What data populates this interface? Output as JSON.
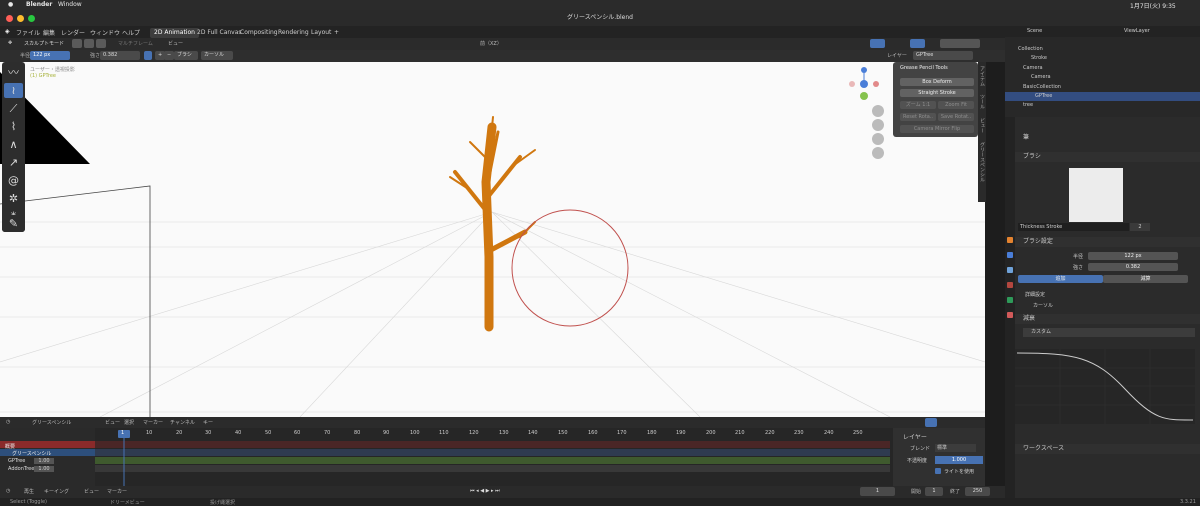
{
  "mac": {
    "app": "Blender",
    "menu_window": "Window",
    "clock": "1月7日(火) 9:35"
  },
  "title": "グリースペンシル.blend",
  "menu": {
    "items": [
      "ファイル",
      "編集",
      "レンダー",
      "ウィンドウ",
      "ヘルプ"
    ]
  },
  "workspaces": {
    "items": [
      "2D Animation",
      "2D Full Canvas",
      "Compositing",
      "Rendering",
      "Layout"
    ],
    "add": "+"
  },
  "header1": {
    "mode": "スカルプトモード",
    "multiframe": "マルチフレーム",
    "view": "ビュー",
    "orientation": "前（XZ）",
    "layer_label": "レイヤー",
    "layer": "GPTree"
  },
  "header2": {
    "radius_label": "半径",
    "radius": "122 px",
    "strength_label": "強さ",
    "strength": "0.382",
    "plus": "+",
    "minus": "−",
    "brush": "ブラシ",
    "cursor": "カーソル"
  },
  "viewport": {
    "overlay_line1": "ユーザー・透視投影",
    "overlay_line2": "(1) GPTree"
  },
  "gp_panel": {
    "title": "Grease Pencil Tools",
    "buttons": [
      "Box Deform",
      "Straight Stroke"
    ],
    "disabled": [
      "ズーム 1:1",
      "Zoom Fit",
      "Reset Rota..",
      "Save Rotat..",
      "Camera Mirror Flip"
    ]
  },
  "sidetabs": [
    "アイテム",
    "ツール",
    "ビュー",
    "グリースペンシル"
  ],
  "outliner": {
    "scene": "Scene",
    "viewlayer": "ViewLayer",
    "rows": [
      "Collection",
      "Stroke",
      "Camera",
      "Camera",
      "BasicCollection",
      "GPTree",
      "tree"
    ]
  },
  "props": {
    "brush_name": "筆",
    "brush_section": "ブラシ",
    "brush_preset": "Thickness Stroke",
    "users": "2",
    "settings_section": "ブラシ設定",
    "radius_label": "半径",
    "radius": "122 px",
    "strength_label": "強さ",
    "strength": "0.382",
    "add": "追加",
    "sub": "減算",
    "advanced": "詳細設定",
    "cursor": "カーソル",
    "falloff": "減衰",
    "custom": "カスタム",
    "workspace": "ワークスペース"
  },
  "timeline": {
    "editor": "グリースペンシル",
    "menus": [
      "ビュー",
      "選択",
      "マーカー",
      "チャンネル",
      "キー"
    ],
    "frames": [
      "1",
      "10",
      "20",
      "30",
      "40",
      "50",
      "60",
      "70",
      "80",
      "90",
      "100",
      "110",
      "120",
      "130",
      "140",
      "150",
      "160",
      "170",
      "180",
      "190",
      "200",
      "210",
      "220",
      "230",
      "240",
      "250"
    ],
    "channels": [
      "概要",
      "グリースペンシル",
      "GPTree",
      "AddonTree"
    ],
    "gptree_value": "1.00",
    "addon_value": "1.00"
  },
  "layer_panel": {
    "title": "レイヤー",
    "blend_label": "ブレンド",
    "blend": "標準",
    "opacity_label": "不透明度",
    "opacity": "1.000",
    "lights": "ライトを使用"
  },
  "bottombar": {
    "playback": "再生",
    "keying": "キーイング",
    "view": "ビュー",
    "marker": "マーカー",
    "current": "1",
    "start_label": "開始",
    "start": "1",
    "end_label": "終了",
    "end": "250"
  },
  "status": {
    "left": "Select (Toggle)",
    "middle": "ドリーメビュー",
    "right": "投げ縄選択",
    "version": "3.3.21"
  },
  "colors": {
    "accent": "#4772b3",
    "tree": "#d0770f",
    "cursor": "#c0504d"
  }
}
